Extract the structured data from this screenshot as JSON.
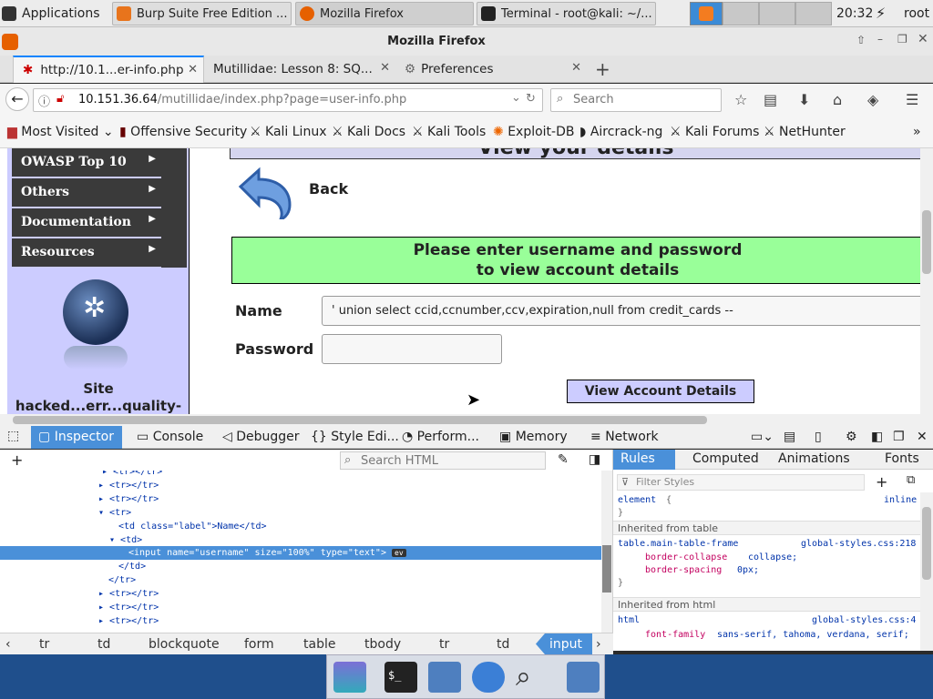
{
  "taskbar": {
    "applications": "Applications",
    "tasks": [
      "Burp Suite Free Edition ...",
      "Mozilla Firefox",
      "Terminal - root@kali: ~/..."
    ],
    "clock": "20:32",
    "user": "root"
  },
  "browser": {
    "window_title": "Mozilla Firefox",
    "tabs": [
      "http://10.1...er-info.php",
      "Mutillidae: Lesson 8: SQ...",
      "Preferences"
    ],
    "url_host": "10.151.36.64",
    "url_path": "/mutillidae/index.php?page=user-info.php",
    "search_placeholder": "Search",
    "bookmarks": [
      "Most Visited",
      "Offensive Security",
      "Kali Linux",
      "Kali Docs",
      "Kali Tools",
      "Exploit-DB",
      "Aircrack-ng",
      "Kali Forums",
      "NetHunter"
    ]
  },
  "page": {
    "heading": "View your details",
    "back_label": "Back",
    "sidebar": [
      "OWASP Top 10",
      "Others",
      "Documentation",
      "Resources"
    ],
    "site_tagline": "Site hacked...err...quality-",
    "banner_line1": "Please enter username and password",
    "banner_line2": "to view account details",
    "name_label": "Name",
    "name_value": "' union select ccid,ccnumber,ccv,expiration,null from credit_cards --",
    "password_label": "Password",
    "password_value": "",
    "submit_label": "View Account Details"
  },
  "devtools": {
    "tabs": [
      "Inspector",
      "Console",
      "Debugger",
      "Style Edi...",
      "Perform...",
      "Memory",
      "Network"
    ],
    "search_placeholder": "Search HTML",
    "markup": [
      "<tr></tr>",
      "<tr></tr>",
      "<tr></tr>",
      "<tr>",
      "<td class=\"label\">Name</td>",
      "<td>",
      "<input name=\"username\" size=\"100%\" type=\"text\">",
      "</td>",
      "</tr>",
      "<tr></tr>",
      "<tr></tr>",
      "<tr></tr>"
    ],
    "ev_badge": "ev",
    "breadcrumbs": [
      "tr",
      "td",
      "blockquote",
      "form",
      "table",
      "tbody",
      "tr",
      "td",
      "input"
    ],
    "rule_tabs": [
      "Rules",
      "Computed",
      "Animations",
      "Fonts"
    ],
    "filter_placeholder": "Filter Styles",
    "rules": {
      "element_selector": "element",
      "element_open": "{",
      "element_close": "}",
      "element_source": "inline",
      "inherited_table": "Inherited from table",
      "table_selector": "table.main-table-frame",
      "table_source": "global-styles.css:218",
      "table_props": [
        [
          "border-collapse",
          "collapse;"
        ],
        [
          "border-spacing",
          "0px;"
        ]
      ],
      "inherited_html": "Inherited from html",
      "html_selector": "html",
      "html_source": "global-styles.css:4",
      "html_props": [
        [
          "font-family",
          "sans-serif, tahoma, verdana, serif;"
        ]
      ]
    }
  },
  "colors": {
    "accent": "#0a84ff",
    "banner": "#99ff99",
    "sidebar": "#3a3a3a",
    "sidepanel": "#ccccff",
    "selected": "#4a90d9",
    "dock": "#1f4f8c"
  }
}
